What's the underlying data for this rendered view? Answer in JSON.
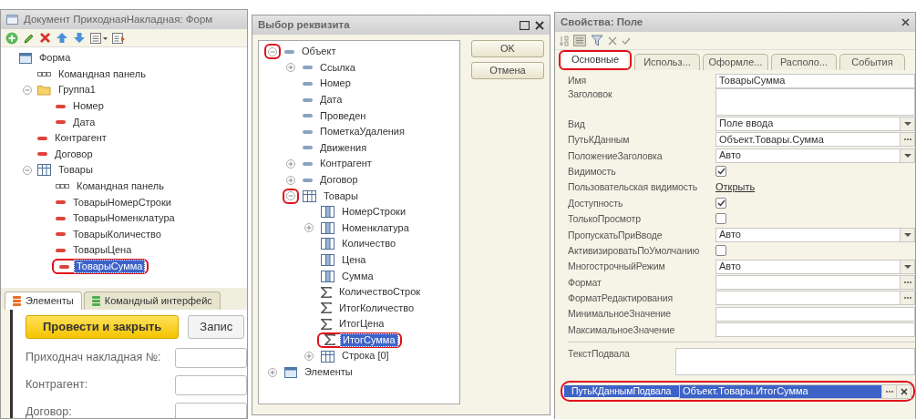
{
  "form_editor": {
    "title": "Документ ПриходнаяНакладная: Форм",
    "tree": [
      {
        "label": "Форма",
        "kind": "form",
        "selected": false,
        "children": [
          {
            "label": "Командная панель",
            "kind": "command-panel",
            "selected": false
          },
          {
            "label": "Группа1",
            "kind": "folder",
            "expanded": true,
            "selected": false,
            "children": [
              {
                "label": "Номер",
                "kind": "field",
                "selected": false
              },
              {
                "label": "Дата",
                "kind": "field",
                "selected": false
              }
            ]
          },
          {
            "label": "Контрагент",
            "kind": "field",
            "selected": false
          },
          {
            "label": "Договор",
            "kind": "field",
            "selected": false
          },
          {
            "label": "Товары",
            "kind": "table",
            "expanded": true,
            "selected": false,
            "children": [
              {
                "label": "Командная панель",
                "kind": "command-panel",
                "selected": false
              },
              {
                "label": "ТоварыНомерСтроки",
                "kind": "field",
                "selected": false
              },
              {
                "label": "ТоварыНоменклатура",
                "kind": "field",
                "selected": false
              },
              {
                "label": "ТоварыКоличество",
                "kind": "field",
                "selected": false
              },
              {
                "label": "ТоварыЦена",
                "kind": "field",
                "selected": false
              },
              {
                "label": "ТоварыСумма",
                "kind": "field",
                "selected": true,
                "highlighted": true
              }
            ]
          }
        ]
      }
    ],
    "tabs": [
      {
        "label": "Элементы",
        "color": "#e8702a",
        "selected": true
      },
      {
        "label": "Командный интерфейс",
        "color": "#4caf50",
        "selected": false
      }
    ],
    "form_preview": {
      "buttons": [
        {
          "label": "Провести и закрыть",
          "kind": "default"
        },
        {
          "label": "Запис",
          "kind": "normal"
        }
      ],
      "fields": [
        {
          "label": "Приходнач накладная №:"
        },
        {
          "label": "Контрагент:"
        },
        {
          "label": "Договор:"
        }
      ]
    }
  },
  "attribute_dialog": {
    "title": "Выбор реквизита",
    "tree": [
      {
        "label": "Объект",
        "kind": "attribute",
        "expanded": true,
        "selected": false,
        "toggle_highlighted": true,
        "children": [
          {
            "label": "Ссылка",
            "kind": "attribute",
            "expanded": false,
            "selected": false
          },
          {
            "label": "Номер",
            "kind": "attribute",
            "selected": false
          },
          {
            "label": "Дата",
            "kind": "attribute",
            "selected": false
          },
          {
            "label": "Проведен",
            "kind": "attribute",
            "selected": false
          },
          {
            "label": "ПометкаУдаления",
            "kind": "attribute",
            "selected": false
          },
          {
            "label": "Движения",
            "kind": "attribute",
            "selected": false
          },
          {
            "label": "Контрагент",
            "kind": "attribute",
            "expanded": false,
            "selected": false
          },
          {
            "label": "Договор",
            "kind": "attribute",
            "expanded": false,
            "selected": false
          },
          {
            "label": "Товары",
            "kind": "table",
            "expanded": true,
            "selected": false,
            "toggle_highlighted": true,
            "children": [
              {
                "label": "НомерСтроки",
                "kind": "column",
                "selected": false
              },
              {
                "label": "Номенклатура",
                "kind": "column",
                "expanded": false,
                "selected": false
              },
              {
                "label": "Количество",
                "kind": "column",
                "selected": false
              },
              {
                "label": "Цена",
                "kind": "column",
                "selected": false
              },
              {
                "label": "Сумма",
                "kind": "column",
                "selected": false
              },
              {
                "label": "КоличествоСтрок",
                "kind": "sum",
                "selected": false
              },
              {
                "label": "ИтогКоличество",
                "kind": "sum",
                "selected": false
              },
              {
                "label": "ИтогЦена",
                "kind": "sum",
                "selected": false
              },
              {
                "label": "ИтогСумма",
                "kind": "sum",
                "selected": true,
                "highlighted": true
              },
              {
                "label": "Строка [0]",
                "kind": "table",
                "expanded": false,
                "selected": false
              }
            ]
          }
        ]
      },
      {
        "label": "Элементы",
        "kind": "form",
        "expanded": false,
        "selected": false
      }
    ],
    "buttons": [
      {
        "label": "OK"
      },
      {
        "label": "Отмена"
      }
    ]
  },
  "properties": {
    "title": "Свойства: Поле",
    "tabs": [
      {
        "label": "Основные",
        "selected": true,
        "highlighted": true
      },
      {
        "label": "Использ...",
        "selected": false
      },
      {
        "label": "Оформле...",
        "selected": false
      },
      {
        "label": "Располо...",
        "selected": false
      },
      {
        "label": "События",
        "selected": false
      }
    ],
    "rows": [
      {
        "kind": "text",
        "label": "Имя",
        "value": "ТоварыСумма"
      },
      {
        "kind": "textarea",
        "label": "Заголовок"
      },
      {
        "kind": "select",
        "label": "Вид",
        "value": "Поле ввода"
      },
      {
        "kind": "choice",
        "label": "ПутьКДанным",
        "value": "Объект.Товары.Сумма"
      },
      {
        "kind": "select",
        "label": "ПоложениеЗаголовка",
        "value": "Авто"
      },
      {
        "kind": "checkbox",
        "label": "Видимость",
        "checked": true
      },
      {
        "kind": "link",
        "label": "Пользовательская видимость",
        "value": "Открыть"
      },
      {
        "kind": "checkbox",
        "label": "Доступность",
        "checked": true
      },
      {
        "kind": "checkbox",
        "label": "ТолькоПросмотр",
        "checked": false
      },
      {
        "kind": "select",
        "label": "ПропускатьПриВводе",
        "value": "Авто"
      },
      {
        "kind": "checkbox",
        "label": "АктивизироватьПоУмолчанию",
        "checked": false
      },
      {
        "kind": "select",
        "label": "МногострочныйРежим",
        "value": "Авто"
      },
      {
        "kind": "choice",
        "label": "Формат"
      },
      {
        "kind": "choice",
        "label": "ФорматРедактирования"
      },
      {
        "kind": "text",
        "label": "МинимальноеЗначение"
      },
      {
        "kind": "text",
        "label": "МаксимальноеЗначение"
      }
    ],
    "footer_rows": [
      {
        "kind": "textarea",
        "label": "ТекстПодвала",
        "selected": false
      },
      {
        "kind": "choice-clear",
        "label": "ПутьКДаннымПодвала",
        "value": "Объект.Товары.ИтогСумма",
        "selected": true,
        "highlighted": true
      }
    ]
  }
}
